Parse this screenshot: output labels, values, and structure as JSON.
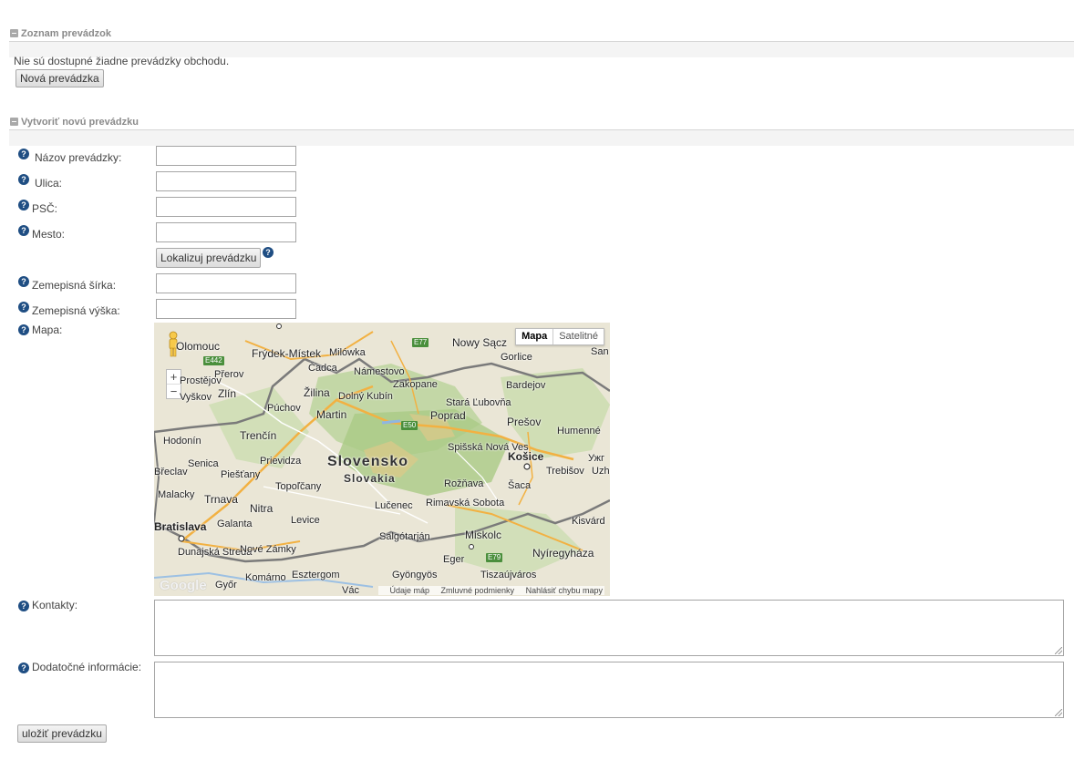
{
  "list_section": {
    "title": "Zoznam prevádzok",
    "empty_message": "Nie sú dostupné žiadne prevádzky obchodu.",
    "new_button": "Nová prevádzka"
  },
  "create_section": {
    "title": "Vytvoriť novú prevádzku",
    "fields": {
      "name_label": "Názov prevádzky:",
      "street_label": "Ulica:",
      "zip_label": "PSČ:",
      "city_label": "Mesto:",
      "locate_button": "Lokalizuj prevádzku",
      "lat_label": "Zemepisná šírka:",
      "lng_label": "Zemepisná výška:",
      "map_label": "Mapa:",
      "contacts_label": "Kontakty:",
      "info_label": "Dodatočné informácie:"
    },
    "save_button": "uložiť prevádzku"
  },
  "help_icon": "question-circle-icon",
  "map": {
    "type_buttons": [
      "Mapa",
      "Satelitné"
    ],
    "active_type": "Mapa",
    "zoom_in": "+",
    "zoom_out": "−",
    "logo": "Google",
    "footer": [
      "Údaje máp",
      "Zmluvné podmienky",
      "Nahlásiť chybu mapy"
    ],
    "labels": {
      "country": "Slovensko",
      "country_sub": "Slovakia",
      "cities": [
        "Olomouc",
        "Frýdek-Místek",
        "Milówka",
        "Nowy Sącz",
        "Gorlice",
        "San",
        "Prostějov",
        "Přerov",
        "Čadca",
        "Námestovo",
        "Zakopane",
        "Bardejov",
        "Vyškov",
        "Zlín",
        "Žilina",
        "Dolný Kubín",
        "Stará Ľubovňa",
        "Púchov",
        "Martin",
        "Poprad",
        "Prešov",
        "Humenné",
        "Hodonín",
        "Trenčín",
        "Spišská Nová Ves",
        "Košice",
        "Ужг",
        "Břeclav",
        "Senica",
        "Prievidza",
        "Trebišov",
        "Uzhl",
        "Piešťany",
        "Malacky",
        "Trnava",
        "Topoľčany",
        "Rožňava",
        "Šaca",
        "Nitra",
        "Lučenec",
        "Rimavská Sobota",
        "Bratislava",
        "Galanta",
        "Levice",
        "Kisvárd",
        "Salgótarján",
        "Miskolc",
        "Dunajská Streda",
        "Nové Zámky",
        "Eger",
        "Nyíregyháza",
        "Komárno",
        "Esztergom",
        "Gyöngyös",
        "Tiszaújváros",
        "Győr",
        "Vác"
      ],
      "roads": [
        "E77",
        "E442",
        "E50",
        "E79"
      ]
    }
  }
}
